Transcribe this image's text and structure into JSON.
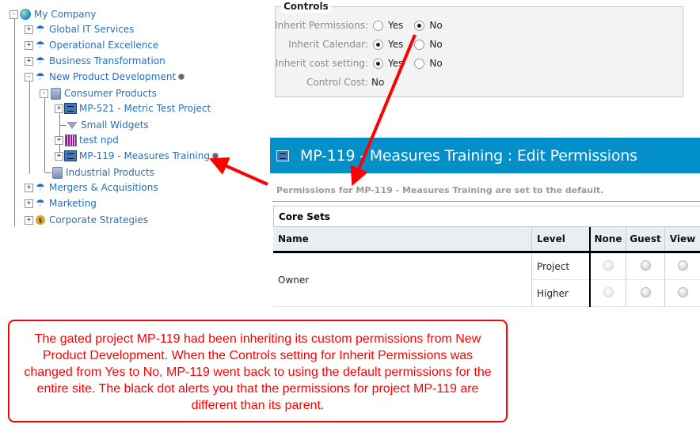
{
  "tree": {
    "nodes": [
      {
        "label": "My Company",
        "icon": "globe-icon",
        "toggle": "-",
        "dot": false
      },
      {
        "label": "Global IT Services",
        "icon": "umbrella-icon",
        "toggle": "+",
        "dot": false
      },
      {
        "label": "Operational Excellence",
        "icon": "umbrella-icon",
        "toggle": "+",
        "dot": false
      },
      {
        "label": "Business Transformation",
        "icon": "umbrella-icon",
        "toggle": "+",
        "dot": false
      },
      {
        "label": "New Product Development",
        "icon": "umbrella-icon",
        "toggle": "-",
        "dot": true
      },
      {
        "label": "Consumer Products",
        "icon": "database-icon",
        "toggle": "-",
        "dot": false
      },
      {
        "label": "MP-521 - Metric Test Project",
        "icon": "project-icon",
        "toggle": "+",
        "dot": false
      },
      {
        "label": "Small Widgets",
        "icon": "funnel-icon",
        "toggle": "",
        "dot": false
      },
      {
        "label": "test npd",
        "icon": "npd-icon",
        "toggle": "+",
        "dot": false
      },
      {
        "label": "MP-119 - Measures Training",
        "icon": "project-icon",
        "toggle": "+",
        "dot": true
      },
      {
        "label": "Industrial Products",
        "icon": "database-icon",
        "toggle": "",
        "dot": false
      },
      {
        "label": "Mergers & Acquisitions",
        "icon": "umbrella-icon",
        "toggle": "+",
        "dot": false
      },
      {
        "label": "Marketing",
        "icon": "umbrella-icon",
        "toggle": "+",
        "dot": false
      },
      {
        "label": "Corporate Strategies",
        "icon": "money-bag-icon",
        "toggle": "+",
        "dot": false
      }
    ]
  },
  "controls": {
    "legend": "Controls",
    "rows": [
      {
        "label": "Inherit Permissions:",
        "yes": "Yes",
        "no": "No",
        "selected": "No"
      },
      {
        "label": "Inherit Calendar:",
        "yes": "Yes",
        "no": "No",
        "selected": "Yes"
      },
      {
        "label": "Inherit cost setting:",
        "yes": "Yes",
        "no": "No",
        "selected": "Yes"
      }
    ],
    "control_cost_label": "Control Cost:",
    "control_cost_value": "No"
  },
  "permissions": {
    "title": "MP-119 - Measures Training : Edit Permissions",
    "subtitle": "Permissions for MP-119 - Measures Training are set to the default.",
    "section": "Core Sets",
    "columns": [
      "Name",
      "Level",
      "None",
      "Guest",
      "View"
    ],
    "rows": [
      {
        "name": "Owner",
        "levels": [
          "Project",
          "Higher"
        ]
      }
    ]
  },
  "callout": {
    "text": "The gated project MP-119 had been inheriting its custom permissions from New Product Development. When the Controls setting for Inherit Permissions was changed from Yes to No, MP-119 went back to using the default permissions for the entire site. The black dot alerts you that the permissions for project MP-119 are different than its parent.",
    "color": "#ff0000"
  },
  "colors": {
    "title_bar": "#0390c9",
    "tree_link": "#2b6fb6",
    "annotation": "#ff0000"
  }
}
